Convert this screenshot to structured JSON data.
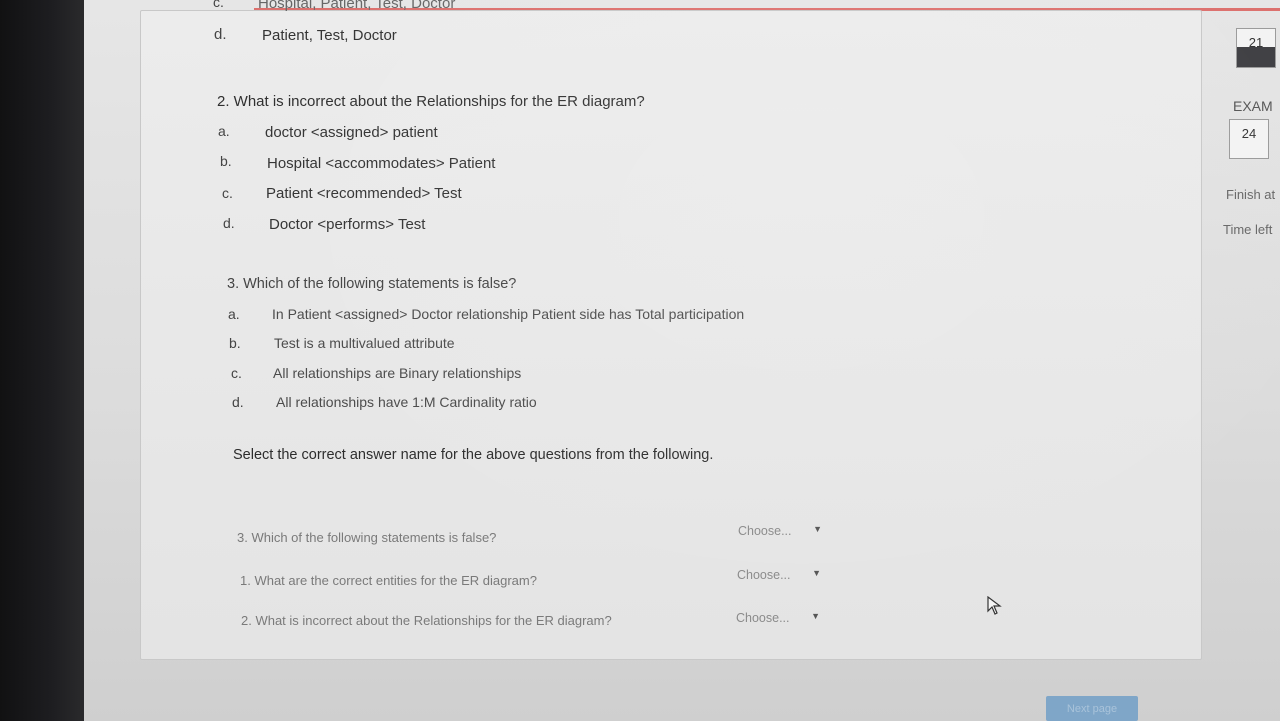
{
  "question1_tail": {
    "letter_c": "c.",
    "option_c": "Hospital, Patient, Test, Doctor",
    "letter_d": "d.",
    "option_d": "Patient, Test, Doctor"
  },
  "question2": {
    "text": "2. What is incorrect about the Relationships for the ER diagram?",
    "options": [
      {
        "letter": "a.",
        "text": "doctor <assigned> patient"
      },
      {
        "letter": "b.",
        "text": "Hospital <accommodates> Patient"
      },
      {
        "letter": "c.",
        "text": "Patient <recommended> Test"
      },
      {
        "letter": "d.",
        "text": "Doctor <performs> Test"
      }
    ]
  },
  "question3": {
    "text": "3. Which of the following statements is false?",
    "options": [
      {
        "letter": "a.",
        "text": "In Patient <assigned> Doctor relationship Patient side has Total participation"
      },
      {
        "letter": "b.",
        "text": "Test is a multivalued attribute"
      },
      {
        "letter": "c.",
        "text": "All relationships are Binary relationships"
      },
      {
        "letter": "d.",
        "text": "All relationships have 1:M Cardinality ratio"
      }
    ]
  },
  "matching": {
    "instruction": "Select the correct answer name for the above questions from the following.",
    "rows": [
      {
        "question": "3. Which of the following statements is false?",
        "selected": "Choose..."
      },
      {
        "question": "1. What are the correct entities for the ER diagram?",
        "selected": "Choose..."
      },
      {
        "question": "2. What is incorrect about the Relationships for the ER diagram?",
        "selected": "Choose..."
      }
    ]
  },
  "side_panel": {
    "box_top": "21",
    "exam_label": "EXAM",
    "box_exam": "24",
    "finish_label": "Finish at",
    "time_left_label": "Time left"
  },
  "next_button": "Next page",
  "colors": {
    "accent_rule": "#d9534f",
    "button_blue": "#7fa6c8"
  }
}
